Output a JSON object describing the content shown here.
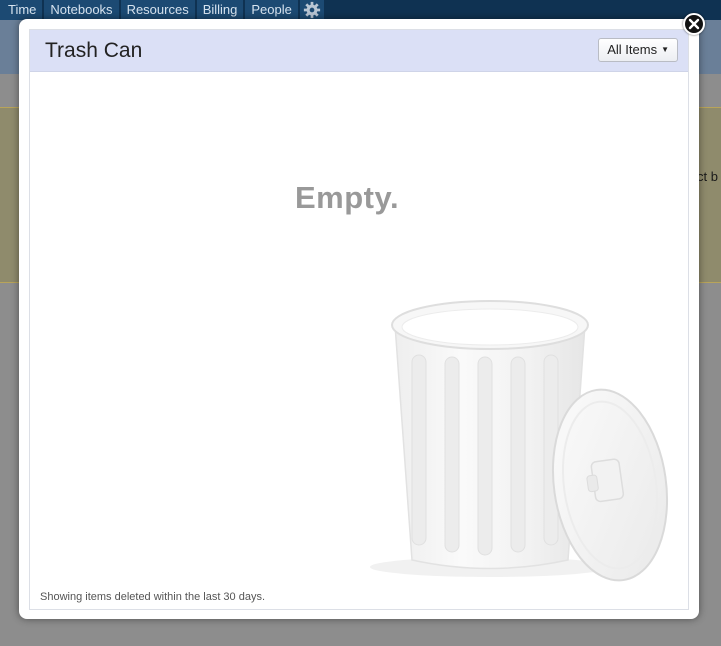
{
  "nav": {
    "items": [
      {
        "label": "Time"
      },
      {
        "label": "Notebooks"
      },
      {
        "label": "Resources"
      },
      {
        "label": "Billing"
      },
      {
        "label": "People"
      }
    ],
    "settings_icon": "gear-icon"
  },
  "background": {
    "snippet_text": "ct b"
  },
  "modal": {
    "title": "Trash Can",
    "filter_label": "All Items",
    "filter_icon": "caret-down-icon",
    "empty_text": "Empty.",
    "footer_note": "Showing items deleted within the last 30 days.",
    "close_icon": "close-icon",
    "illustration": "trash-can-icon"
  },
  "colors": {
    "nav_bg": "#0f3252",
    "header_bg": "#dbe0f6",
    "empty_text": "#999999"
  }
}
